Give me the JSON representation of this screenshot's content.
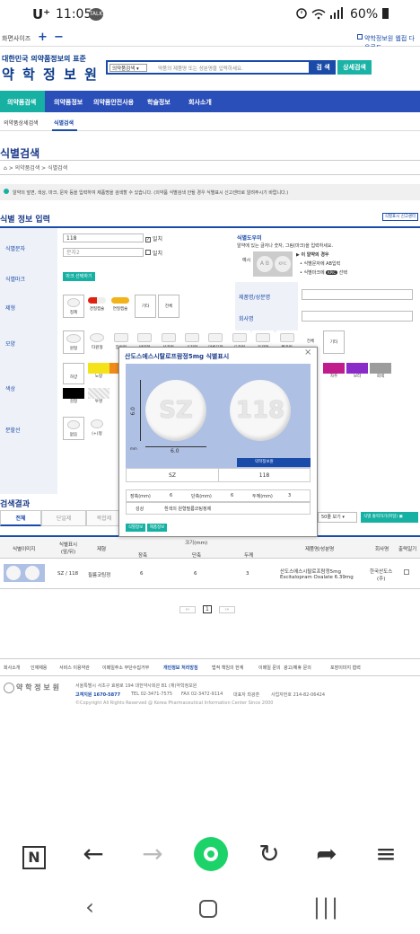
{
  "status": {
    "carrier": "U⁺",
    "time": "11:05",
    "talk": "TALK",
    "battery": "60%"
  },
  "urlbar": {
    "left_label": "화면사이즈",
    "plus": "+",
    "minus": "−",
    "right_label": "약학정보원 웹접 다운로드"
  },
  "site": {
    "tagline": "대한민국 의약품정보의 표준",
    "name": "약 학 정 보 원"
  },
  "search": {
    "category": "의약품검색",
    "placeholder": "약품의 제품명 또는 성분명을 입력하세요.",
    "search_btn": "검 색",
    "detail_btn": "상세검색"
  },
  "nav": {
    "items": [
      "의약품검색",
      "의약품정보",
      "의약품안전사용",
      "학술정보",
      "회사소개"
    ]
  },
  "subnav": {
    "items": [
      "의약품상세검색",
      "식별검색"
    ]
  },
  "page": {
    "title": "식별검색",
    "breadcrumb_1": "의약품검색",
    "breadcrumb_2": "식별검색"
  },
  "notice": "알약의 앞면, 색상, 마크, 문자 등을 입력하여 제품명을 검색할 수 있습니다. (의약품 식별검색 안될 경우 식별표시 신고센터로 알려주시기 바랍니다.)",
  "form": {
    "title": "식별 정보 입력",
    "report_btn": "식별표시 신고센터",
    "label_text": "식별문자",
    "text_value": "118",
    "text_placeholder": "문자2",
    "exact_match": "일치",
    "label_mark": "식별마크",
    "mark_btn": "마크 선택하기",
    "label_form": "제형",
    "forms": [
      "정제",
      "경질캡슐",
      "연질캡슐",
      "기타",
      "전체"
    ],
    "label_shape": "모양",
    "shapes": [
      "원형",
      "타원형",
      "장방형",
      "반원형",
      "삼각형",
      "사각형",
      "마름모형",
      "오각형",
      "육각형",
      "팔각형",
      "전체",
      "기타"
    ],
    "label_color": "색상",
    "colors": [
      {
        "name": "하양",
        "hex": "#ffffff"
      },
      {
        "name": "노랑",
        "hex": "#f5e31a"
      },
      {
        "name": "주황",
        "hex": "#f08a1a"
      },
      {
        "name": "자주",
        "hex": "#c01c8c"
      },
      {
        "name": "보라",
        "hex": "#8a2ac8"
      },
      {
        "name": "회색",
        "hex": "#9c9c9c"
      },
      {
        "name": "검정",
        "hex": "#000000"
      },
      {
        "name": "투명",
        "hex": "#e8e8e8"
      }
    ],
    "label_line": "분할선",
    "lines": [
      "없음",
      "(+)형"
    ],
    "help_title": "식별도우미",
    "help_text": "알약에 있는 글자나 숫자, 그림(마크)을 입력하세요.",
    "help_example": "예시",
    "help_item1": "이 알약의 경우",
    "help_item2": "식별문자에 AB입력",
    "help_item3": "식별마크에",
    "help_item3_suffix": "선택",
    "label_product": "제품명/성분명",
    "label_company": "회사명"
  },
  "popup": {
    "title": "산도스에스시탈로프람정5mg 식별표시",
    "front": "SZ",
    "back": "118",
    "dim_h": "6.0",
    "dim_w": "6.0",
    "unit": "mm",
    "watermark": "약학정보원",
    "front_label": "SZ",
    "back_label": "118",
    "length_label": "장축(mm)",
    "length": "6",
    "width_label": "단축(mm)",
    "width": "6",
    "thick_label": "두께(mm)",
    "thick": "3",
    "prop_label": "성상",
    "prop": "흰색의 원형필름코팅정제",
    "btn_info": "식별정보",
    "btn_product": "제품정보"
  },
  "results": {
    "title": "검색결과",
    "tabs": [
      "전체",
      "단일제",
      "복합제"
    ],
    "per_page": "50줄 보기",
    "excel_btn": "식별 출력하기(파일)",
    "headers": {
      "image": "식별이미지",
      "mark": "식별표시(앞/뒤)",
      "form": "제형",
      "size": "크기(mm)",
      "long": "장축",
      "short": "단축",
      "thick": "두께",
      "name": "제품명/성분명",
      "company": "회사명",
      "print": "출력일기"
    },
    "row": {
      "mark": "SZ / 118",
      "form": "필름코팅정",
      "long": "6",
      "short": "6",
      "thick": "3",
      "name1": "산도스에스시탈로프람정5mg",
      "name2": "Escitalopram Oxalate   6.39mg",
      "company1": "한국산도스",
      "company2": "(주)"
    },
    "page": "1"
  },
  "footer": {
    "links": [
      "회사소개",
      "인재채용",
      "서비스 이용약관",
      "이메일주소 무단수집거부",
      "개인정보 처리방침",
      "법적 책임의 한계",
      "이메일 문의",
      "광고/제휴 문의",
      "포장이미지 협력"
    ],
    "logo": "약 학 정 보 원",
    "address": "서울특별시 서초구 효령로 194 대한약사회관 B1 (재)약학정보원",
    "phone_label": "고객지원 1670-5877",
    "tel": "TEL 02-3471-7575",
    "fax": "FAX 02-3472-9114",
    "ceo": "대표자 최광훈",
    "bizno": "사업자번호 214-82-06424",
    "copyright": "©Copyright All Rights Reserved @ Korea Pharmaceutical Information Center Since 2000"
  }
}
